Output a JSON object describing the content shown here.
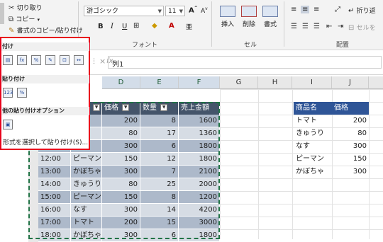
{
  "ribbon": {
    "clipboard": {
      "cut": "切り取り",
      "copy": "コピー",
      "format_painter": "書式のコピー/貼り付け"
    },
    "font": {
      "name": "游ゴシック",
      "size": "11",
      "group_label": "フォント"
    },
    "cells": {
      "insert": "挿入",
      "delete": "削除",
      "format": "書式",
      "group_label": "セル"
    },
    "alignment": {
      "wrap": "折り返",
      "merge": "セルを",
      "group_label": "配置"
    }
  },
  "formula_bar": {
    "fx": "fx",
    "content": "列1"
  },
  "columns": [
    "D",
    "E",
    "F",
    "G",
    "H",
    "I",
    "J"
  ],
  "table": {
    "headers": [
      "価格",
      "数量",
      "売上金額"
    ],
    "rows": [
      {
        "time": "",
        "item": "",
        "price": "200",
        "qty": "8",
        "sales": "1600"
      },
      {
        "time": "",
        "item": "り",
        "price": "80",
        "qty": "17",
        "sales": "1360"
      },
      {
        "time": "",
        "item": "",
        "price": "300",
        "qty": "6",
        "sales": "1800"
      },
      {
        "time": "12:00",
        "item": "ピーマン",
        "price": "150",
        "qty": "12",
        "sales": "1800"
      },
      {
        "time": "13:00",
        "item": "かぼちゃ",
        "price": "300",
        "qty": "7",
        "sales": "2100"
      },
      {
        "time": "14:00",
        "item": "きゅうり",
        "price": "80",
        "qty": "25",
        "sales": "2000"
      },
      {
        "time": "15:00",
        "item": "ピーマン",
        "price": "150",
        "qty": "8",
        "sales": "1200"
      },
      {
        "time": "16:00",
        "item": "なす",
        "price": "300",
        "qty": "14",
        "sales": "4200"
      },
      {
        "time": "17:00",
        "item": "トマト",
        "price": "200",
        "qty": "15",
        "sales": "3000"
      },
      {
        "time": "18:00",
        "item": "かぼちゃ",
        "price": "300",
        "qty": "6",
        "sales": "1800"
      }
    ]
  },
  "side_table": {
    "headers": [
      "商品名",
      "価格"
    ],
    "rows": [
      {
        "name": "トマト",
        "price": "200"
      },
      {
        "name": "きゅうり",
        "price": "80"
      },
      {
        "name": "なす",
        "price": "300"
      },
      {
        "name": "ピーマン",
        "price": "150"
      },
      {
        "name": "かぼちゃ",
        "price": "300"
      }
    ]
  },
  "paste_menu": {
    "section1": "付け",
    "section2": "貼り付け",
    "section3": "他の貼り付けオプション",
    "special": "形式を選択して貼り付け(S)..."
  }
}
